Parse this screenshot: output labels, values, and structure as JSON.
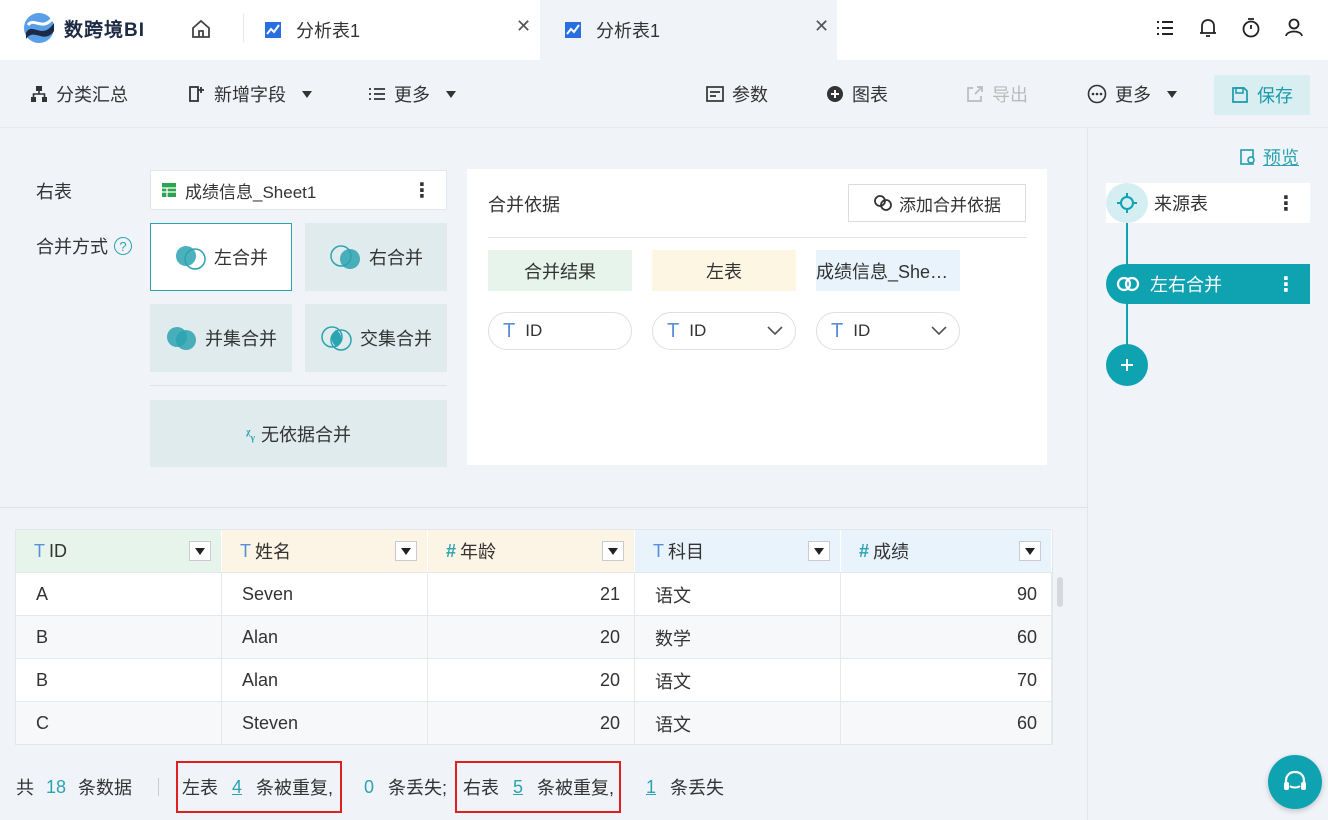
{
  "app": {
    "brand": "数跨境BI"
  },
  "tabs": [
    {
      "label": "分析表1",
      "active": false
    },
    {
      "label": "分析表1",
      "active": true
    }
  ],
  "toolbar": {
    "group": "分类汇总",
    "add_field": "新增字段",
    "more_left": "更多",
    "params": "参数",
    "chart": "图表",
    "export": "导出",
    "more_right": "更多",
    "save": "保存"
  },
  "merge": {
    "right_table_label": "右表",
    "right_table_value": "成绩信息_Sheet1",
    "mode_label": "合并方式",
    "modes": {
      "left": "左合并",
      "right": "右合并",
      "union": "并集合并",
      "intersect": "交集合并",
      "none": "无依据合并"
    },
    "selected_mode": "左合并",
    "basis_title": "合并依据",
    "add_basis": "添加合并依据",
    "headers": {
      "result": "合并结果",
      "left": "左表",
      "right": "成绩信息_She…"
    },
    "fields": {
      "result": "ID",
      "left": "ID",
      "right": "ID"
    }
  },
  "table": {
    "columns": [
      {
        "type": "T",
        "name": "ID"
      },
      {
        "type": "T",
        "name": "姓名"
      },
      {
        "type": "#",
        "name": "年龄"
      },
      {
        "type": "T",
        "name": "科目"
      },
      {
        "type": "#",
        "name": "成绩"
      }
    ],
    "rows": [
      [
        "A",
        "Seven",
        "21",
        "语文",
        "90"
      ],
      [
        "B",
        "Alan",
        "20",
        "数学",
        "60"
      ],
      [
        "B",
        "Alan",
        "20",
        "语文",
        "70"
      ],
      [
        "C",
        "Steven",
        "20",
        "语文",
        "60"
      ]
    ]
  },
  "footer": {
    "total_prefix": "共",
    "total_count": "18",
    "total_suffix": "条数据",
    "left_label": "左表",
    "left_dup": "4",
    "dup_suffix": "条被重复,",
    "left_lost": "0",
    "lost_suffix_1": "条丢失;",
    "right_label": "右表",
    "right_dup": "5",
    "right_lost": "1",
    "lost_suffix_2": "条丢失"
  },
  "flow": {
    "preview": "预览",
    "source": "来源表",
    "merge": "左右合并"
  },
  "colors": {
    "accent": "#0fa3b1",
    "red": "#e02020"
  }
}
